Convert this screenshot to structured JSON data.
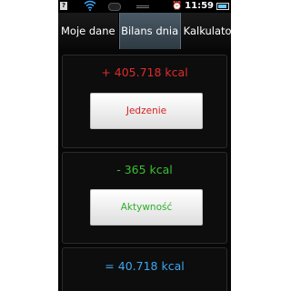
{
  "status_bar": {
    "left_icon_glyph": "?",
    "time": "11:59",
    "icons": [
      "notification-icon",
      "wifi-icon",
      "signal-icon",
      "alarm-icon",
      "battery-icon"
    ]
  },
  "tabs": [
    {
      "label": "Moje dane",
      "active": false
    },
    {
      "label": "Bilans dnia",
      "active": true
    },
    {
      "label": "Kalkulatory",
      "active": false
    }
  ],
  "intake": {
    "value_text": "+ 405.718 kcal",
    "button_label": "Jedzenie"
  },
  "activity": {
    "value_text": "- 365 kcal",
    "button_label": "Aktywność"
  },
  "balance": {
    "value_text": "= 40.718 kcal"
  },
  "colors": {
    "intake": "#e02b2b",
    "activity": "#3bbf33",
    "balance": "#3ea6f0",
    "active_tab": "#3b4a56"
  }
}
